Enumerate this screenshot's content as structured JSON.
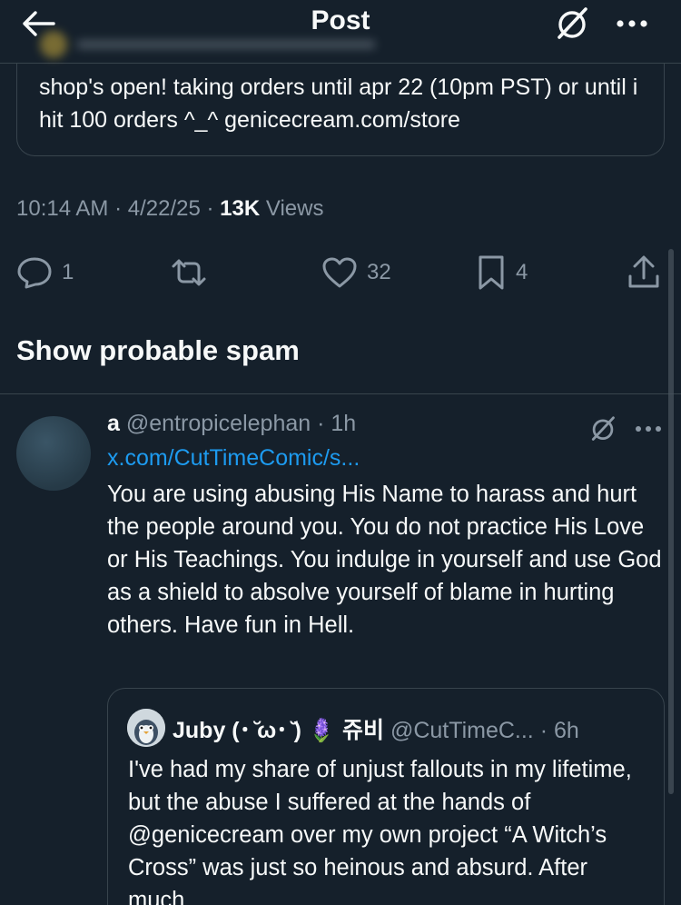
{
  "header": {
    "title": "Post",
    "back_icon": "arrow-left-icon",
    "grok_icon": "grok-icon",
    "more_icon": "more-horizontal-icon"
  },
  "quoted_post": {
    "text": "shop's open! taking orders until apr 22 (10pm PST) or until i hit 100 orders ^_^ genicecream.com/store"
  },
  "meta": {
    "time": "10:14 AM",
    "date": "4/22/25",
    "views_count": "13K",
    "views_label": "Views"
  },
  "actions": {
    "replies": "1",
    "reposts": "",
    "likes": "32",
    "bookmarks": "4"
  },
  "spam_label": "Show probable spam",
  "reply": {
    "name": "a",
    "handle": "@entropicelephan",
    "time": "1h",
    "link": "x.com/CutTimeComic/s...",
    "text": "You are using abusing His Name to harass and hurt the people around you. You do not practice His Love or His Teachings. You indulge in yourself and use God as a shield to absolve yourself of blame in hurting others. Have fun in Hell."
  },
  "quote": {
    "name": "Juby (･ ̆ω･ ̆) 🪻 쥬비",
    "handle": "@CutTimeC...",
    "time": "6h",
    "text": "I've had my share of unjust fallouts in my lifetime, but the abuse I suffered at the hands of @genicecream over my own project “A Witch’s Cross” was just so heinous and absurd. After much"
  },
  "colors": {
    "background": "#15202b",
    "border": "#38444d",
    "muted": "#8b98a5",
    "link": "#1d9bf0",
    "text": "#f7f9f9"
  }
}
